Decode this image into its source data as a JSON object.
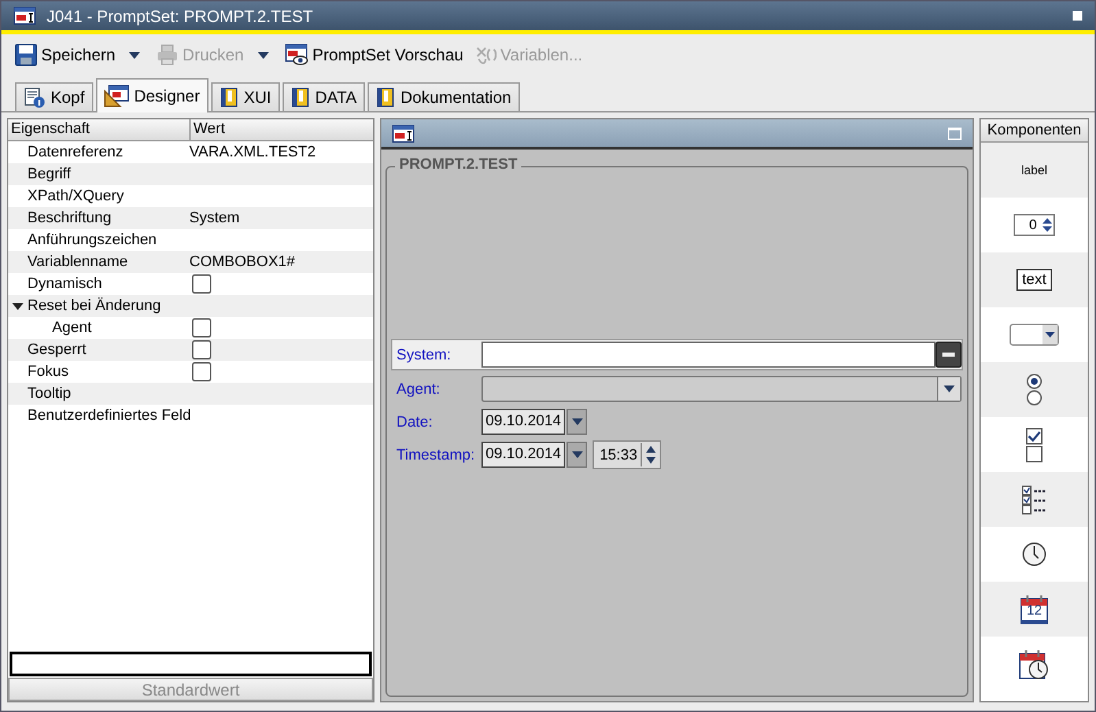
{
  "window": {
    "title": "J041 - PromptSet: PROMPT.2.TEST"
  },
  "toolbar": [
    {
      "label": "Speichern",
      "disabled": false,
      "dropdown": true
    },
    {
      "label": "Drucken",
      "disabled": true,
      "dropdown": true
    },
    {
      "label": "PromptSet Vorschau",
      "disabled": false,
      "dropdown": false
    },
    {
      "label": "Variablen...",
      "disabled": true,
      "dropdown": false
    }
  ],
  "tabs": [
    {
      "label": "Kopf",
      "selected": false
    },
    {
      "label": "Designer",
      "selected": true
    },
    {
      "label": "XUI",
      "selected": false
    },
    {
      "label": "DATA",
      "selected": false
    },
    {
      "label": "Dokumentation",
      "selected": false
    }
  ],
  "properties": {
    "columns": [
      "Eigenschaft",
      "Wert"
    ],
    "rows": [
      {
        "name": "Datenreferenz",
        "kind": "text",
        "value": "VARA.XML.TEST2"
      },
      {
        "name": "Begriff",
        "kind": "text"
      },
      {
        "name": "XPath/XQuery",
        "kind": "text"
      },
      {
        "name": "Beschriftung",
        "kind": "text",
        "value": "System"
      },
      {
        "name": "Anführungszeichen",
        "kind": "text"
      },
      {
        "name": "Variablenname",
        "kind": "text",
        "value": "COMBOBOX1#"
      },
      {
        "name": "Dynamisch",
        "kind": "check",
        "checked": false
      },
      {
        "name": "Reset bei Änderung",
        "kind": "group",
        "expanded": true,
        "children": [
          {
            "name": "Agent",
            "kind": "check",
            "checked": false
          }
        ]
      },
      {
        "name": "Gesperrt",
        "kind": "check",
        "checked": false
      },
      {
        "name": "Fokus",
        "kind": "check",
        "checked": false
      },
      {
        "name": "Tooltip",
        "kind": "text"
      },
      {
        "name": "Benutzerdefiniertes Feld",
        "kind": "text"
      }
    ],
    "default_button": "Standardwert"
  },
  "form": {
    "title": "PROMPT.2.TEST",
    "fields": [
      {
        "label": "System:",
        "kind": "text",
        "selected": true
      },
      {
        "label": "Agent:",
        "kind": "combo",
        "selected": false
      },
      {
        "label": "Date:",
        "kind": "date",
        "value": "09.10.2014",
        "selected": false
      },
      {
        "label": "Timestamp:",
        "kind": "datetime",
        "value": "09.10.2014",
        "time": "15:33",
        "selected": false
      }
    ]
  },
  "components": {
    "title": "Komponenten",
    "items": [
      {
        "kind": "label",
        "text": "label"
      },
      {
        "kind": "spinner",
        "text": "0"
      },
      {
        "kind": "textbox",
        "text": "text"
      },
      {
        "kind": "combo"
      },
      {
        "kind": "radio"
      },
      {
        "kind": "check"
      },
      {
        "kind": "checklist"
      },
      {
        "kind": "clock"
      },
      {
        "kind": "calendar",
        "text": "12"
      },
      {
        "kind": "calendarclock"
      }
    ]
  }
}
